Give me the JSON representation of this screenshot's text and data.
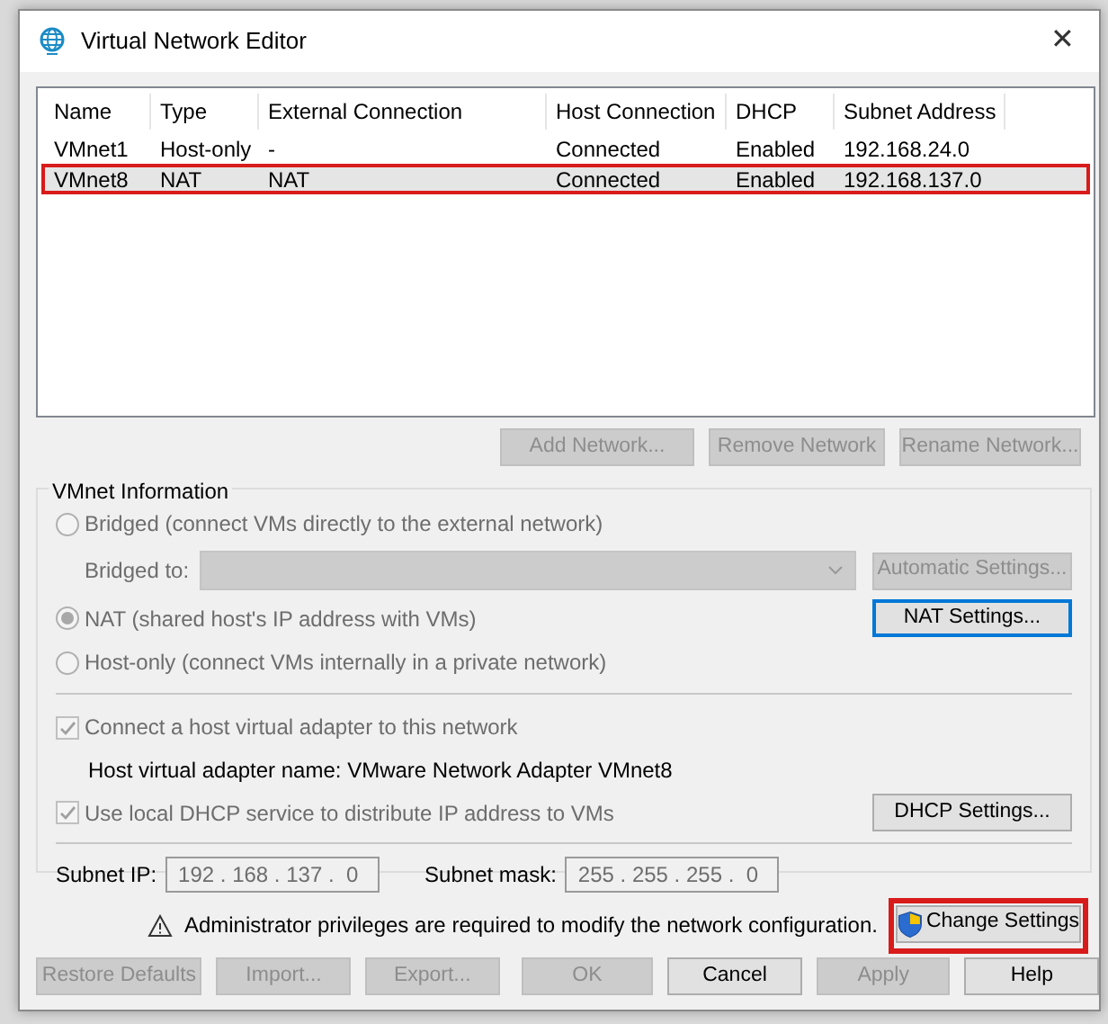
{
  "window": {
    "title": "Virtual Network Editor",
    "close": "✕"
  },
  "table": {
    "columns": [
      "Name",
      "Type",
      "External Connection",
      "Host Connection",
      "DHCP",
      "Subnet Address"
    ],
    "rows": [
      {
        "cells": [
          "VMnet1",
          "Host-only",
          "-",
          "Connected",
          "Enabled",
          "192.168.24.0"
        ],
        "selected": false,
        "highlighted": false
      },
      {
        "cells": [
          "VMnet8",
          "NAT",
          "NAT",
          "Connected",
          "Enabled",
          "192.168.137.0"
        ],
        "selected": true,
        "highlighted": true
      }
    ]
  },
  "network_buttons": [
    {
      "label": "Add Network...",
      "disabled": true
    },
    {
      "label": "Remove Network",
      "disabled": true
    },
    {
      "label": "Rename Network...",
      "disabled": true
    }
  ],
  "vmnet_info": {
    "title": "VMnet Information",
    "bridged": {
      "label": "Bridged (connect VMs directly to the external network)",
      "selected": false,
      "disabled": true
    },
    "bridged_to": {
      "label": "Bridged to:",
      "disabled": true
    },
    "automatic_settings": {
      "label": "Automatic Settings...",
      "disabled": true
    },
    "nat": {
      "label": "NAT (shared host's IP address with VMs)",
      "selected": true,
      "disabled": true
    },
    "nat_settings": {
      "label": "NAT Settings...",
      "disabled": false,
      "focused": true
    },
    "host_only": {
      "label": "Host-only (connect VMs internally in a private network)",
      "selected": false,
      "disabled": true
    },
    "connect_adapter": {
      "label": "Connect a host virtual adapter to this network",
      "checked": true,
      "disabled": true
    },
    "adapter_name": "Host virtual adapter name: VMware Network Adapter VMnet8",
    "use_dhcp": {
      "label": "Use local DHCP service to distribute IP address to VMs",
      "checked": true,
      "disabled": true
    },
    "dhcp_settings": {
      "label": "DHCP Settings...",
      "disabled": false,
      "focused": false
    },
    "subnet_ip": {
      "label": "Subnet IP:",
      "value": "192 . 168 . 137 .  0"
    },
    "subnet_mask": {
      "label": "Subnet mask:",
      "value": "255 . 255 . 255 .  0"
    }
  },
  "notice": {
    "text": "Administrator privileges are required to modify the network configuration.",
    "button": {
      "label": "Change Settings",
      "highlighted": true
    }
  },
  "footer_buttons": [
    {
      "label": "Restore Defaults",
      "disabled": true
    },
    {
      "label": "Import...",
      "disabled": true
    },
    {
      "label": "Export...",
      "disabled": true
    },
    {
      "label": "OK",
      "disabled": true
    },
    {
      "label": "Cancel",
      "disabled": false
    },
    {
      "label": "Apply",
      "disabled": true
    },
    {
      "label": "Help",
      "disabled": false
    }
  ]
}
